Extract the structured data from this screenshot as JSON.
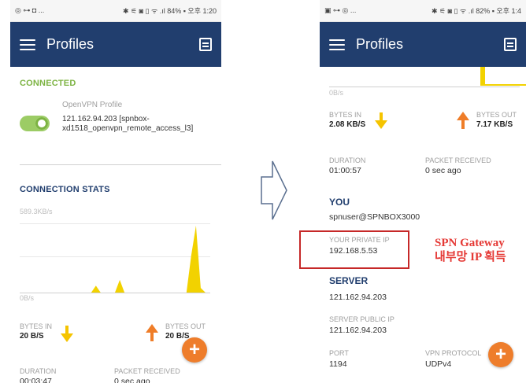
{
  "left_phone": {
    "statusbar": {
      "left": "◎ ⊶ ◘ ...",
      "right": "✱ ⚟ ◙ ▯ ᯤ .ıl 84% ▪ 오후 1:20"
    },
    "appbar": {
      "title": "Profiles",
      "menu_icon": "hamburger-menu-icon",
      "import_icon": "import-profile-icon"
    },
    "connected_label": "CONNECTED",
    "profile": {
      "name": "OpenVPN Profile",
      "detail": "121.162.94.203 [spnbox-xd1518_openvpn_remote_access_l3]",
      "toggle_on": true
    },
    "stats_label": "CONNECTION STATS",
    "chart_top_label": "589.3KB/s",
    "chart_bottom_label": "0B/s",
    "bytes_in_label": "BYTES IN",
    "bytes_in_value": "20 B/S",
    "bytes_out_label": "BYTES OUT",
    "bytes_out_value": "20 B/S",
    "duration_label": "DURATION",
    "duration_value": "00:03:47",
    "packet_label": "PACKET RECEIVED",
    "packet_value": "0 sec ago"
  },
  "right_phone": {
    "statusbar": {
      "left": "▣ ⊶ ◎ ...",
      "right": "✱ ⚟ ◙ ▯ ᯤ .ıl 82% ▪ 오후 1:4"
    },
    "appbar": {
      "title": "Profiles",
      "menu_icon": "hamburger-menu-icon",
      "import_icon": "import-profile-icon"
    },
    "chart_bottom_label": "0B/s",
    "bytes_in_label": "BYTES IN",
    "bytes_in_value": "2.08 KB/S",
    "bytes_out_label": "BYTES OUT",
    "bytes_out_value": "7.17 KB/S",
    "duration_label": "DURATION",
    "duration_value": "01:00:57",
    "packet_label": "PACKET RECEIVED",
    "packet_value": "0 sec ago",
    "you_label": "YOU",
    "you_value": "spnuser@SPNBOX3000",
    "private_ip_label": "YOUR PRIVATE IP",
    "private_ip_value": "192.168.5.53",
    "server_label": "SERVER",
    "server_value": "121.162.94.203",
    "server_public_ip_label": "SERVER PUBLIC IP",
    "server_public_ip_value": "121.162.94.203",
    "port_label": "PORT",
    "port_value": "1194",
    "vpn_protocol_label": "VPN PROTOCOL",
    "vpn_protocol_value": "UDPv4"
  },
  "annotation": {
    "line1": "SPN Gateway",
    "line2": "내부망 IP 획득"
  },
  "colors": {
    "appbar": "#213e6e",
    "connected": "#7cb342",
    "chart": "#f2d200",
    "down_arrow": "#f5c400",
    "up_arrow": "#ef7d28",
    "fab": "#ee7d2b",
    "annotation": "#e53935"
  },
  "chart_data": {
    "type": "area",
    "ylim_label_top": "589.3KB/s",
    "ylim_label_bottom": "0B/s",
    "x": [
      0,
      1,
      2,
      3,
      4,
      5,
      6,
      7,
      8,
      9,
      10,
      11,
      12,
      13,
      14,
      15,
      16,
      17,
      18,
      19,
      20,
      21,
      22,
      23,
      24,
      25,
      26,
      27,
      28,
      29,
      30,
      31,
      32,
      33,
      34,
      35,
      36,
      37,
      38,
      39,
      40
    ],
    "values": [
      0,
      0,
      0,
      0,
      0,
      0,
      0,
      0,
      0,
      0,
      0,
      0,
      0,
      0,
      0,
      0,
      60,
      0,
      0,
      0,
      0,
      110,
      0,
      0,
      0,
      0,
      0,
      0,
      0,
      0,
      0,
      0,
      0,
      0,
      0,
      0,
      320,
      580,
      40,
      0,
      0
    ]
  }
}
